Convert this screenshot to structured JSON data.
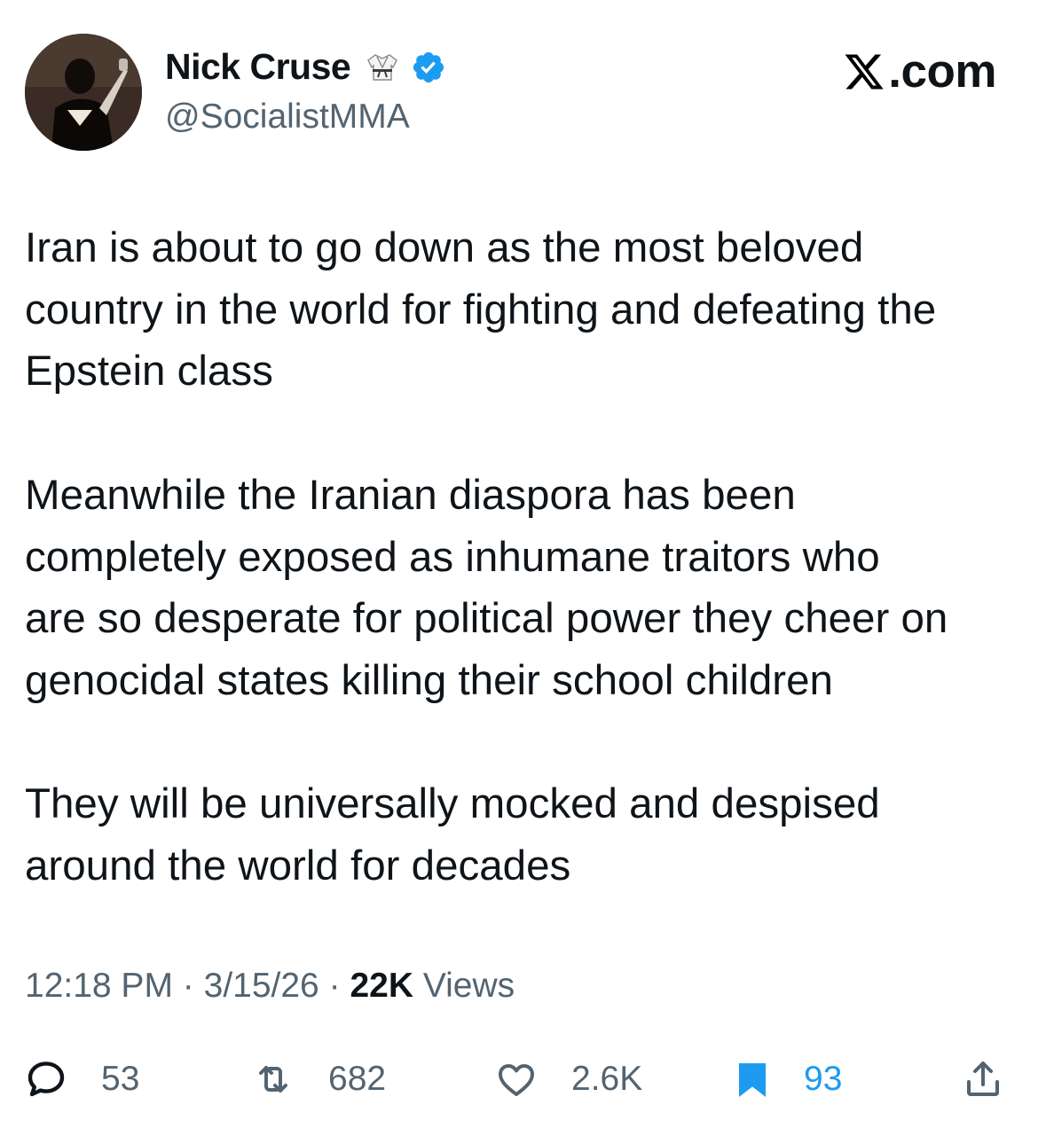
{
  "header": {
    "display_name": "Nick Cruse",
    "handle": "@SocialistMMA",
    "brand": ".com",
    "verified_color": "#1d9bf0"
  },
  "tweet": {
    "paragraphs": [
      {
        "lines": [
          "Iran is about to go down as the most beloved",
          "country in the world for fighting and defeating the",
          "Epstein class"
        ]
      },
      {
        "lines": [
          "Meanwhile the Iranian diaspora has been",
          "completely exposed as inhumane traitors who",
          "are so desperate for political power they cheer on",
          "genocidal states killing their school children"
        ]
      },
      {
        "lines": [
          "They will be universally mocked and despised",
          "around the world for decades"
        ]
      }
    ]
  },
  "meta": {
    "time": "12:18 PM",
    "separator": "·",
    "date": "3/15/26",
    "views_count": "22K",
    "views_label": "Views"
  },
  "actions": {
    "replies": "53",
    "reposts": "682",
    "likes": "2.6K",
    "bookmarks": "93"
  },
  "colors": {
    "text": "#0f1419",
    "secondary": "#536471",
    "accent": "#1d9bf0"
  },
  "icons": [
    "gi-icon",
    "verified-badge-icon",
    "x-logo-icon",
    "reply-icon",
    "repost-icon",
    "like-icon",
    "bookmark-icon",
    "share-icon"
  ]
}
